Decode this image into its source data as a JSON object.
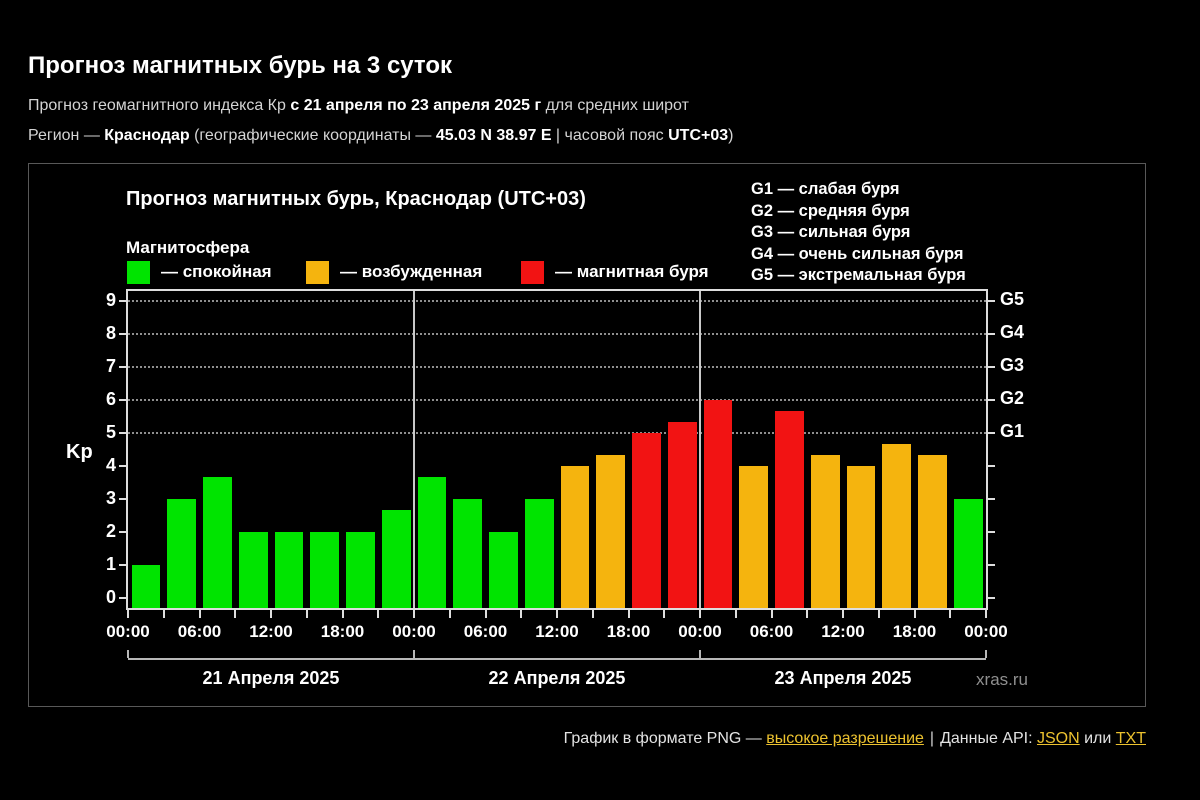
{
  "page": {
    "title": "Прогноз магнитных бурь на 3 суток",
    "subtitle": {
      "prefix": "Прогноз геомагнитного индекса Кр ",
      "bold": "с 21 апреля по 23 апреля 2025 г",
      "suffix": " для средних широт"
    },
    "region": {
      "p1": "Регион — ",
      "b1": "Краснодар",
      "p2": " (географические координаты — ",
      "b2": "45.03 N 38.97 E",
      "p3": " | часовой пояс ",
      "b3": "UTC+03",
      "p4": ")"
    }
  },
  "chart": {
    "title": "Прогноз магнитных бурь, Краснодар (UTC+03)",
    "legend_title": "Магнитосфера",
    "legend": [
      {
        "label": "— спокойная",
        "color": "#00e400",
        "band": "quiet"
      },
      {
        "label": "— возбужденная",
        "color": "#f5b40e",
        "band": "excited"
      },
      {
        "label": "— магнитная буря",
        "color": "#f21313",
        "band": "storm"
      }
    ],
    "g_legend": [
      "G1 — слабая буря",
      "G2 — средняя буря",
      "G3 — сильная буря",
      "G4 — очень сильная буря",
      "G5 — экстремальная буря"
    ],
    "kp_axis_label": "Kp",
    "watermark": "xras.ru"
  },
  "chart_data": {
    "type": "bar",
    "title": "Прогноз магнитных бурь, Краснодар (UTC+03)",
    "ylabel": "Kp",
    "ylim": [
      -0.3,
      9.3
    ],
    "interval_hours": 3,
    "grid": "dotted horizontal at Kp 5-9",
    "y_ticks": [
      0,
      1,
      2,
      3,
      4,
      5,
      6,
      7,
      8,
      9
    ],
    "gridlines_kp": [
      5,
      6,
      7,
      8,
      9
    ],
    "right_axis_labels": [
      {
        "label": "G1",
        "kp": 5
      },
      {
        "label": "G2",
        "kp": 6
      },
      {
        "label": "G3",
        "kp": 7
      },
      {
        "label": "G4",
        "kp": 8
      },
      {
        "label": "G5",
        "kp": 9
      }
    ],
    "x_tick_labels": [
      "00:00",
      "06:00",
      "12:00",
      "18:00",
      "00:00",
      "06:00",
      "12:00",
      "18:00",
      "00:00",
      "06:00",
      "12:00",
      "18:00",
      "00:00"
    ],
    "days": [
      {
        "label": "21 Апреля 2025",
        "values": [
          1,
          3,
          3.67,
          2,
          2,
          2,
          2,
          2.67
        ]
      },
      {
        "label": "22 Апреля 2025",
        "values": [
          3.67,
          3,
          2,
          3,
          4,
          4.33,
          5,
          5.33
        ]
      },
      {
        "label": "23 Апреля 2025",
        "values": [
          6,
          4,
          5.67,
          4.33,
          4,
          4.67,
          4.33,
          3
        ]
      }
    ],
    "series_colors": {
      "quiet": "#00e400",
      "excited": "#f5b40e",
      "storm": "#f21313"
    },
    "color_rule": "kp < 4 quiet (green); 4 <= kp < 5 excited (orange); kp >= 5 storm (red)",
    "legend_position": "top-left inside chart"
  },
  "footer": {
    "text1": "График в формате PNG — ",
    "link1": "высокое разрешение",
    "pipe": "|",
    "text2": "Данные API: ",
    "link2": "JSON",
    "text3": " или ",
    "link3": "TXT",
    "link_color": "#ecc22f"
  }
}
